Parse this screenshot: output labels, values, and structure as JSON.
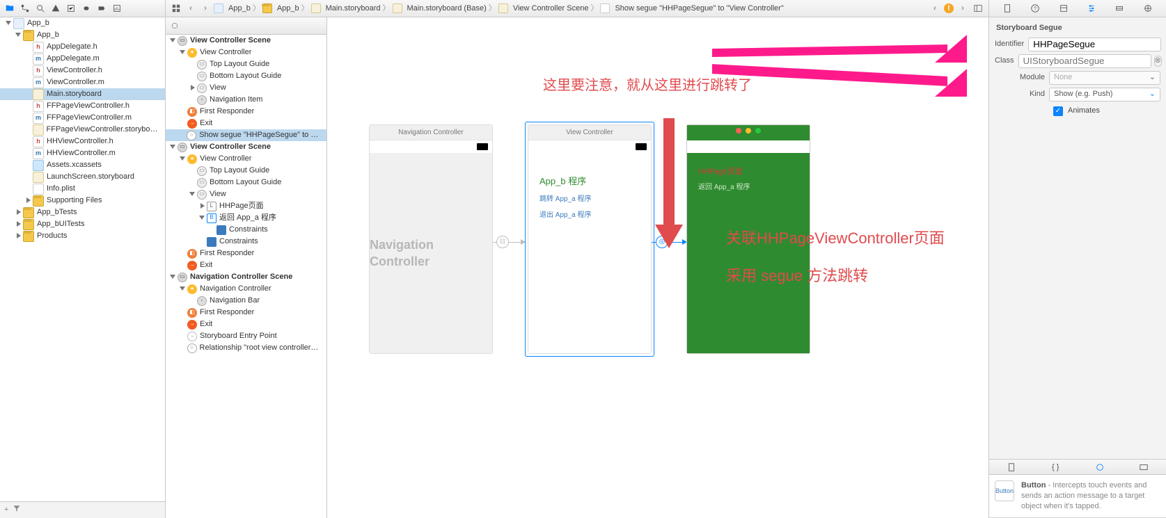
{
  "navigator": {
    "tabs": [
      "folder",
      "repo",
      "search",
      "warn",
      "tests",
      "debug",
      "breakpoints",
      "reports",
      "cloud"
    ],
    "files": [
      {
        "d": 0,
        "t": "app",
        "n": "App_b",
        "tri": "open"
      },
      {
        "d": 1,
        "t": "fold",
        "n": "App_b",
        "tri": "open"
      },
      {
        "d": 2,
        "t": "h",
        "n": "AppDelegate.h",
        "ch": "h"
      },
      {
        "d": 2,
        "t": "m",
        "n": "AppDelegate.m",
        "ch": "m"
      },
      {
        "d": 2,
        "t": "h",
        "n": "ViewController.h",
        "ch": "h"
      },
      {
        "d": 2,
        "t": "m",
        "n": "ViewController.m",
        "ch": "m"
      },
      {
        "d": 2,
        "t": "sb",
        "n": "Main.storyboard",
        "sel": true
      },
      {
        "d": 2,
        "t": "h",
        "n": "FFPageViewController.h",
        "ch": "h"
      },
      {
        "d": 2,
        "t": "m",
        "n": "FFPageViewController.m",
        "ch": "m"
      },
      {
        "d": 2,
        "t": "sb",
        "n": "FFPageViewController.storyboard"
      },
      {
        "d": 2,
        "t": "h",
        "n": "HHViewController.h",
        "ch": "h"
      },
      {
        "d": 2,
        "t": "m",
        "n": "HHViewController.m",
        "ch": "m"
      },
      {
        "d": 2,
        "t": "xc",
        "n": "Assets.xcassets"
      },
      {
        "d": 2,
        "t": "sb",
        "n": "LaunchScreen.storyboard"
      },
      {
        "d": 2,
        "t": "pl",
        "n": "Info.plist"
      },
      {
        "d": 2,
        "t": "fold",
        "n": "Supporting Files",
        "tri": "closed"
      },
      {
        "d": 1,
        "t": "fold",
        "n": "App_bTests",
        "tri": "closed"
      },
      {
        "d": 1,
        "t": "fold",
        "n": "App_bUITests",
        "tri": "closed"
      },
      {
        "d": 1,
        "t": "fold",
        "n": "Products",
        "tri": "closed"
      }
    ]
  },
  "outline": [
    {
      "d": 0,
      "k": "head",
      "n": "View Controller Scene",
      "tri": "open"
    },
    {
      "d": 1,
      "k": "vc",
      "n": "View Controller",
      "tri": "open"
    },
    {
      "d": 2,
      "k": "view",
      "n": "Top Layout Guide"
    },
    {
      "d": 2,
      "k": "view",
      "n": "Bottom Layout Guide"
    },
    {
      "d": 2,
      "k": "view",
      "n": "View",
      "tri": "closed"
    },
    {
      "d": 2,
      "k": "nav",
      "n": "Navigation Item"
    },
    {
      "d": 1,
      "k": "fr",
      "n": "First Responder"
    },
    {
      "d": 1,
      "k": "exit",
      "n": "Exit"
    },
    {
      "d": 1,
      "k": "seg",
      "n": "Show segue \"HHPageSegue\" to \"Vi...",
      "sel": true
    },
    {
      "d": 0,
      "k": "head",
      "n": "View Controller Scene",
      "tri": "open"
    },
    {
      "d": 1,
      "k": "vc",
      "n": "View Controller",
      "tri": "open"
    },
    {
      "d": 2,
      "k": "view",
      "n": "Top Layout Guide"
    },
    {
      "d": 2,
      "k": "view",
      "n": "Bottom Layout Guide"
    },
    {
      "d": 2,
      "k": "view",
      "n": "View",
      "tri": "open"
    },
    {
      "d": 3,
      "k": "l",
      "n": "HHPage页面",
      "tri": "closed",
      "ch": "L"
    },
    {
      "d": 3,
      "k": "b",
      "n": "返回 App_a  程序",
      "tri": "open",
      "ch": "B"
    },
    {
      "d": 4,
      "k": "con",
      "n": "Constraints"
    },
    {
      "d": 3,
      "k": "con",
      "n": "Constraints"
    },
    {
      "d": 1,
      "k": "fr",
      "n": "First Responder"
    },
    {
      "d": 1,
      "k": "exit",
      "n": "Exit"
    },
    {
      "d": 0,
      "k": "head",
      "n": "Navigation Controller Scene",
      "tri": "open"
    },
    {
      "d": 1,
      "k": "vc",
      "n": "Navigation Controller",
      "tri": "open"
    },
    {
      "d": 2,
      "k": "nav",
      "n": "Navigation Bar"
    },
    {
      "d": 1,
      "k": "fr",
      "n": "First Responder"
    },
    {
      "d": 1,
      "k": "exit",
      "n": "Exit"
    },
    {
      "d": 1,
      "k": "arrow",
      "n": "Storyboard Entry Point"
    },
    {
      "d": 1,
      "k": "seg",
      "n": "Relationship \"root view controller\" t..."
    }
  ],
  "jumpbar": {
    "items": [
      {
        "ico": "app",
        "t": "App_b"
      },
      {
        "ico": "fold",
        "t": "App_b"
      },
      {
        "ico": "sb",
        "t": "Main.storyboard"
      },
      {
        "ico": "sb",
        "t": "Main.storyboard (Base)"
      },
      {
        "ico": "scene",
        "t": "View Controller Scene"
      },
      {
        "ico": "seg",
        "t": "Show segue \"HHPageSegue\" to \"View Controller\""
      }
    ],
    "warn": "1"
  },
  "canvas": {
    "anno_top": "这里要注意，就从这里进行跳转了",
    "anno_r1": "关联HHPageViewController页面",
    "anno_r2": "采用 segue 方法跳转",
    "sceneA": {
      "title": "Navigation Controller",
      "body": "Navigation Controller"
    },
    "sceneB": {
      "title": "View Controller",
      "h": "App_b 程序",
      "l1": "跳转 App_a 程序",
      "l2": "退出 App_a 程序"
    },
    "sceneC": {
      "title": "",
      "h": "HHPage页面",
      "l1": "返回 App_a 程序"
    }
  },
  "segue": {
    "title": "Storyboard Segue",
    "id_label": "Identifier",
    "id_value": "HHPageSegue",
    "class_label": "Class",
    "class_value": "UIStoryboardSegue",
    "module_label": "Module",
    "module_value": "None",
    "kind_label": "Kind",
    "kind_value": "Show (e.g. Push)",
    "anim_label": "Animates",
    "anim": true
  },
  "library": {
    "title": "Button",
    "name": "Button",
    "desc": " - Intercepts touch events and sends an action message to a target object when it's tapped."
  }
}
